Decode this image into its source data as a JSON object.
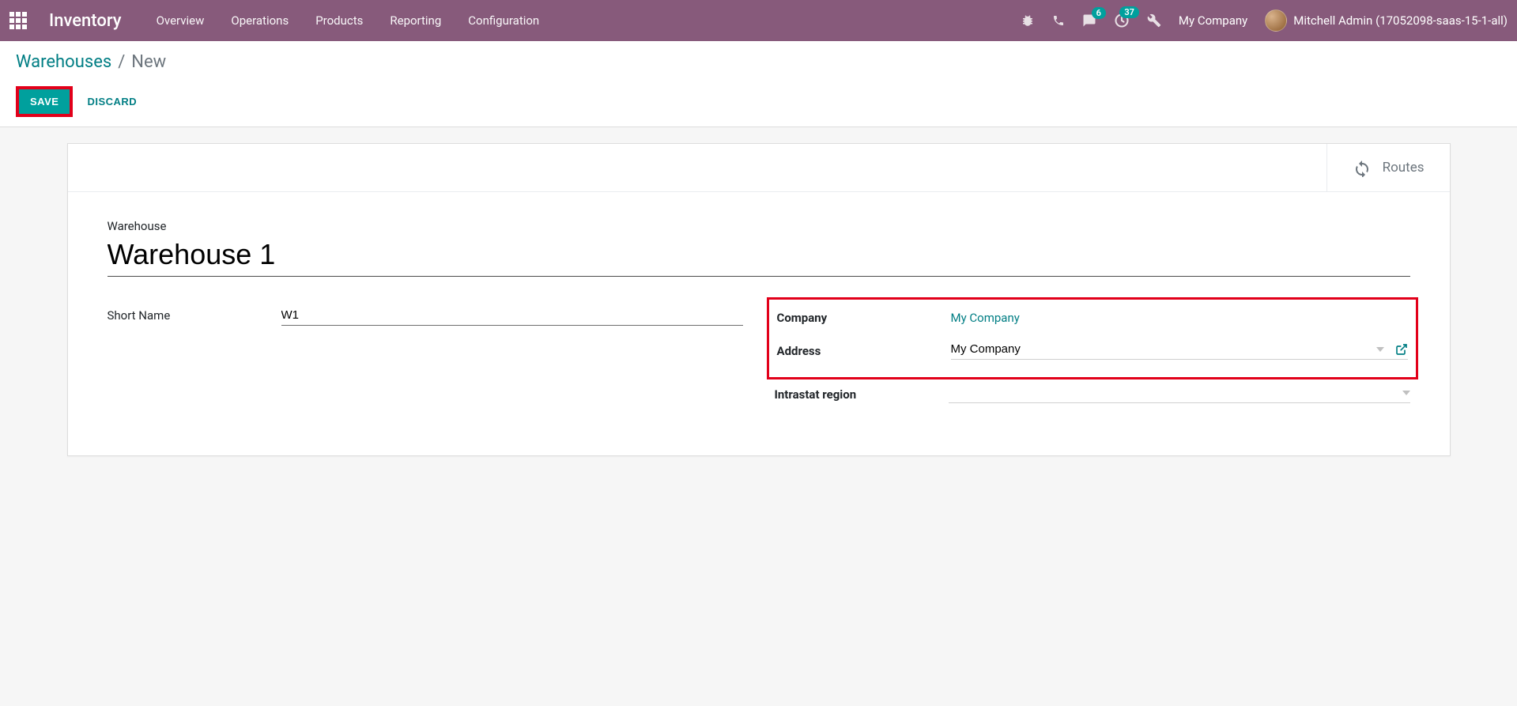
{
  "navbar": {
    "brand": "Inventory",
    "links": [
      "Overview",
      "Operations",
      "Products",
      "Reporting",
      "Configuration"
    ],
    "chat_badge": "6",
    "activity_badge": "37",
    "company": "My Company",
    "user": "Mitchell Admin (17052098-saas-15-1-all)"
  },
  "breadcrumb": {
    "parent": "Warehouses",
    "sep": "/",
    "current": "New"
  },
  "actions": {
    "save": "SAVE",
    "discard": "DISCARD"
  },
  "stat": {
    "routes": "Routes"
  },
  "form": {
    "warehouse_label": "Warehouse",
    "warehouse_value": "Warehouse 1",
    "short_name_label": "Short Name",
    "short_name_value": "W1",
    "company_label": "Company",
    "company_value": "My Company",
    "address_label": "Address",
    "address_value": "My Company",
    "intrastat_label": "Intrastat region",
    "intrastat_value": ""
  }
}
